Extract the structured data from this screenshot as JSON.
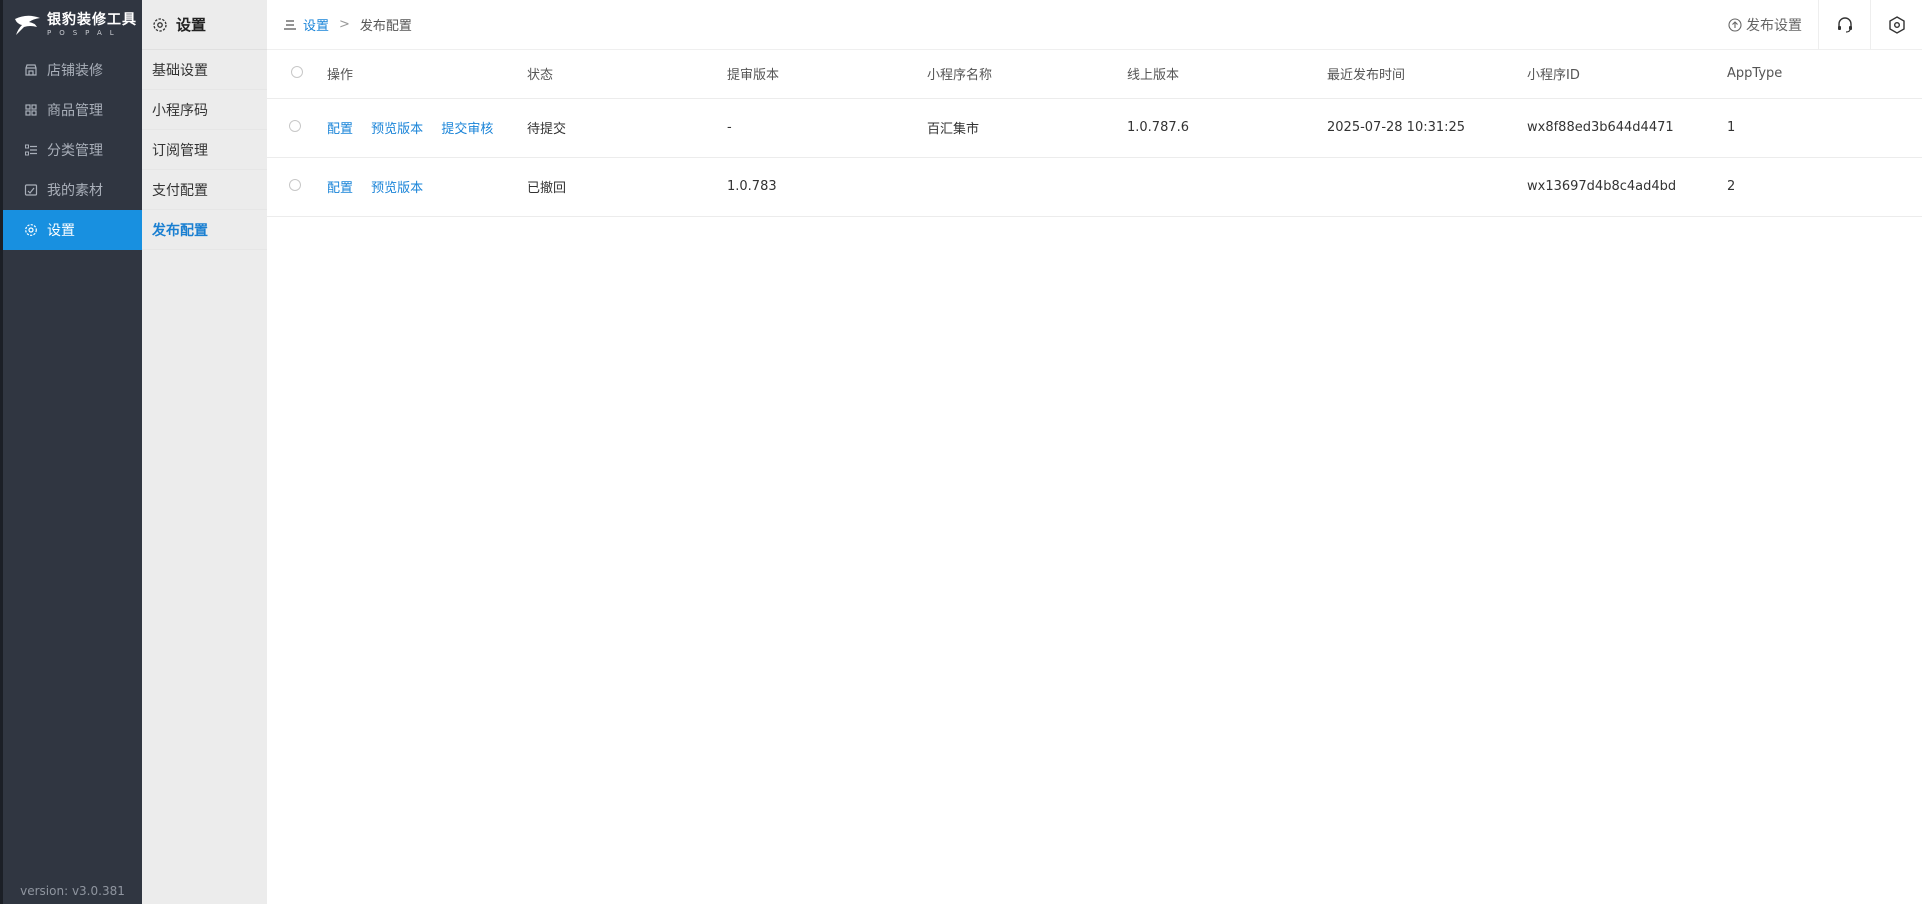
{
  "app": {
    "logo_title": "银豹装修工具",
    "logo_subtitle": "POSPAL",
    "version": "version: v3.0.381"
  },
  "sidebar": {
    "items": [
      {
        "label": "店铺装修",
        "icon": "store-icon"
      },
      {
        "label": "商品管理",
        "icon": "grid-icon"
      },
      {
        "label": "分类管理",
        "icon": "list-icon"
      },
      {
        "label": "我的素材",
        "icon": "image-icon"
      },
      {
        "label": "设置",
        "icon": "gear-icon",
        "active": true
      }
    ]
  },
  "subnav": {
    "title": "设置",
    "items": [
      {
        "label": "基础设置"
      },
      {
        "label": "小程序码"
      },
      {
        "label": "订阅管理"
      },
      {
        "label": "支付配置"
      },
      {
        "label": "发布配置",
        "active": true
      }
    ]
  },
  "breadcrumb": {
    "parent": "设置",
    "separator": ">",
    "current": "发布配置"
  },
  "topbar": {
    "publish_settings_label": "发布设置"
  },
  "table": {
    "headers": {
      "actions": "操作",
      "status": "状态",
      "review_version": "提审版本",
      "app_name": "小程序名称",
      "online_version": "线上版本",
      "last_publish": "最近发布时间",
      "app_id": "小程序ID",
      "app_type": "AppType"
    },
    "rows": [
      {
        "actions": [
          "配置",
          "预览版本",
          "提交审核"
        ],
        "status": "待提交",
        "review_version": "-",
        "app_name": "百汇集市",
        "online_version": "1.0.787.6",
        "last_publish": "2025-07-28 10:31:25",
        "app_id": "wx8f88ed3b644d4471",
        "app_type": "1"
      },
      {
        "actions": [
          "配置",
          "预览版本"
        ],
        "status": "已撤回",
        "review_version": "1.0.783",
        "app_name": "",
        "online_version": "",
        "last_publish": "",
        "app_id": "wx13697d4b8c4ad4bd",
        "app_type": "2"
      }
    ]
  },
  "colors": {
    "sidebar_bg": "#303641",
    "active_blue": "#1890e0",
    "link_blue": "#1a84d8",
    "subnav_bg": "#ececec"
  }
}
